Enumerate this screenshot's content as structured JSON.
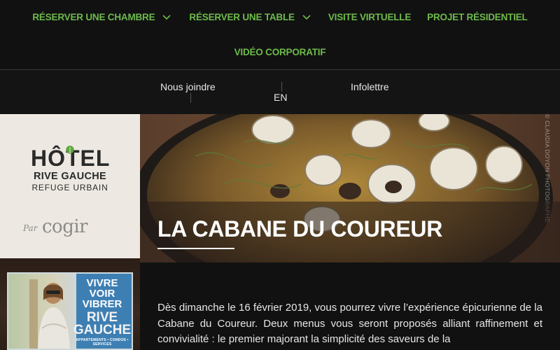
{
  "nav": {
    "items": [
      {
        "label": "RÉSERVER UNE CHAMBRE",
        "has_dropdown": true
      },
      {
        "label": "RÉSERVER UNE TABLE",
        "has_dropdown": true
      },
      {
        "label": "VISITE VIRTUELLE",
        "has_dropdown": false
      },
      {
        "label": "PROJET RÉSIDENTIEL",
        "has_dropdown": false
      }
    ],
    "second_row": {
      "label": "VIDÉO CORPORATIF"
    },
    "accent_color": "#6dbb4a"
  },
  "subbar": {
    "contact": "Nous joindre",
    "language": "EN",
    "newsletter": "Infolettre"
  },
  "logo": {
    "line1": "HÔTEL",
    "line2": "RIVE GAUCHE",
    "line3": "REFUGE URBAIN",
    "par": "Par",
    "brand": "cogir"
  },
  "ad": {
    "line1": "VIVRE",
    "line2": "VOIR",
    "line3": "VIBRER",
    "line4": "RIVE",
    "line5": "GAUCHE",
    "tagline": "APPARTEMENTS • CONDOS • SERVICES"
  },
  "hero": {
    "title": "LA CABANE DU COUREUR",
    "photo_credit": "© CLAUDIA DOYON PHOTOGRAPHE"
  },
  "content": {
    "paragraph": "Dès dimanche le 16 février 2019, vous pourrez vivre l’expérience épicurienne de la Cabane du Coureur. Deux menus vous seront proposés alliant raffinement et convivialité : le premier majorant la simplicité des saveurs de la"
  }
}
